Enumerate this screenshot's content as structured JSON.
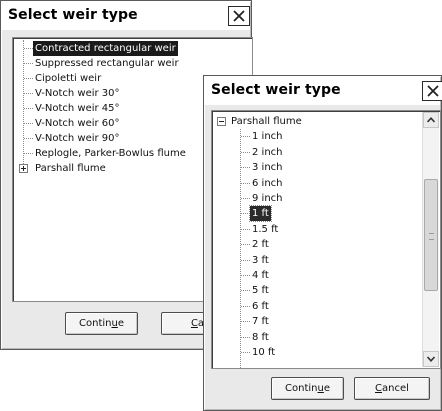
{
  "dialogs": [
    {
      "title": "Select weir type",
      "close_glyph": "✕",
      "items": [
        {
          "label": "Contracted rectangular weir",
          "selected": true
        },
        {
          "label": "Suppressed rectangular weir"
        },
        {
          "label": "Cipoletti weir"
        },
        {
          "label": "V-Notch weir 30°"
        },
        {
          "label": "V-Notch weir 45°"
        },
        {
          "label": "V-Notch weir 60°"
        },
        {
          "label": "V-Notch weir 90°"
        },
        {
          "label": "Replogle, Parker-Bowlus flume"
        },
        {
          "label": "Parshall flume",
          "expander": "plus"
        }
      ],
      "buttons": {
        "continue": {
          "pre": "Contin",
          "u": "u",
          "post": "e"
        },
        "cancel": {
          "pre": "",
          "u": "C",
          "post": "a"
        }
      }
    },
    {
      "title": "Select weir type",
      "close_glyph": "✕",
      "root": {
        "label": "Parshall flume",
        "expander": "minus"
      },
      "children": [
        {
          "label": "1 inch"
        },
        {
          "label": "2 inch"
        },
        {
          "label": "3 inch"
        },
        {
          "label": "6 inch"
        },
        {
          "label": "9 inch"
        },
        {
          "label": "1 ft",
          "selected": true
        },
        {
          "label": "1.5 ft"
        },
        {
          "label": "2 ft"
        },
        {
          "label": "3 ft"
        },
        {
          "label": "4 ft"
        },
        {
          "label": "5 ft"
        },
        {
          "label": "6 ft"
        },
        {
          "label": "7 ft"
        },
        {
          "label": "8 ft"
        },
        {
          "label": "10 ft"
        }
      ],
      "scroll_position": 0.45,
      "buttons": {
        "continue": {
          "pre": "Contin",
          "u": "u",
          "post": "e"
        },
        "cancel": {
          "pre": "",
          "u": "C",
          "post": "ancel"
        }
      }
    }
  ]
}
